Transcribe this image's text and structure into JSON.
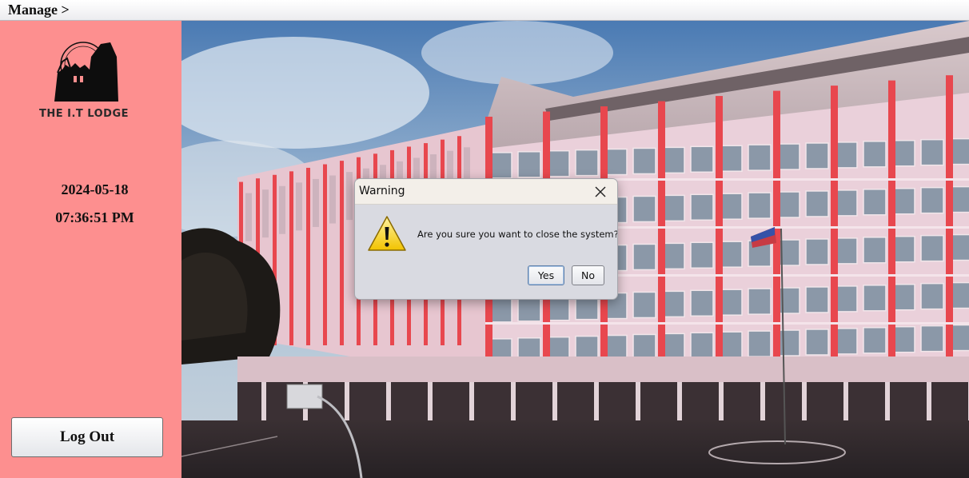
{
  "menubar": {
    "manage_label": "Manage >"
  },
  "sidebar": {
    "logo_text": "THE I.T LODGE",
    "date": "2024-05-18",
    "time": "07:36:51 PM",
    "logout_label": "Log Out"
  },
  "dialog": {
    "title": "Warning",
    "message": "Are you sure you want to close the system?",
    "yes_label": "Yes",
    "no_label": "No",
    "icon": "warning-icon"
  },
  "colors": {
    "sidebar_bg": "#fd8f8f",
    "building_wall": "#e8c4cf",
    "building_pillars": "#e8474e",
    "dialog_bg": "#d9dae1"
  }
}
